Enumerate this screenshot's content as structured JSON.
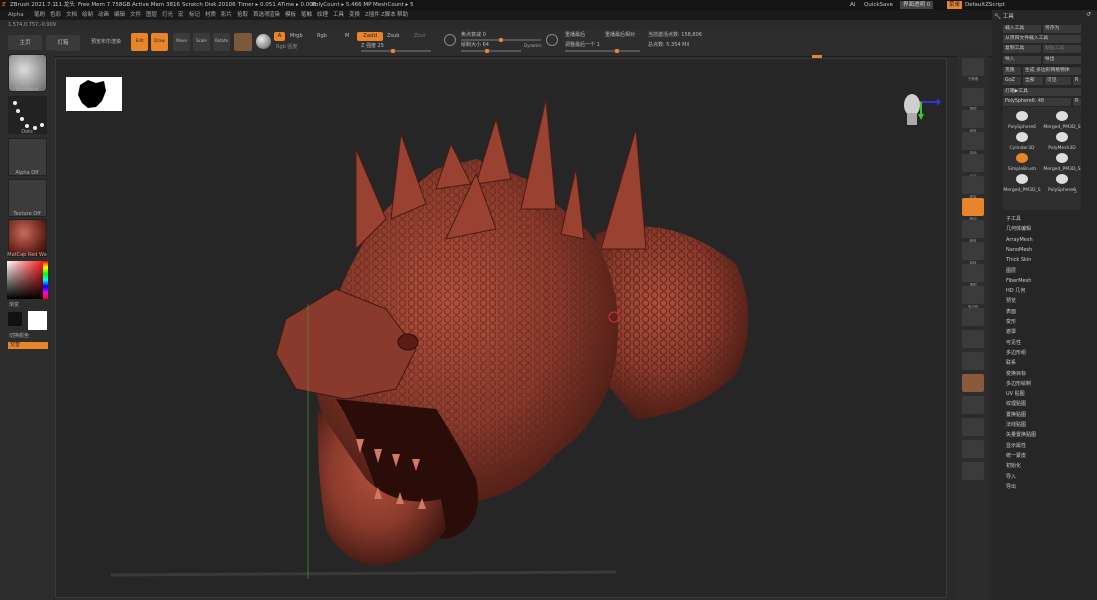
{
  "status": {
    "app": "ZBrush 2021.7.1",
    "tool": "11.龙头",
    "free_mem": "Free Mem 7.758GB",
    "active_mem": "Active Mem 3816",
    "scratch": "Scratch Disk 20106",
    "timer": "Timer ▸ 0.051 ATime ▸ 0.008",
    "polycount": "PolyCount ▸ 5.466 MP",
    "meshcount": "MeshCount ▸ 5",
    "quicksave": "QuickSave",
    "transp": "界面透明 0",
    "menu_label": "菜单",
    "script": "DefaultZScript",
    "ai": "AI"
  },
  "menus": [
    "Alpha",
    "笔刷",
    "色彩",
    "文档",
    "绘制",
    "动画",
    "编辑",
    "文件",
    "图层",
    "灯光",
    "宏",
    "标记",
    "材质",
    "影片",
    "拾取",
    "首选项",
    "渲染",
    "模板",
    "笔触",
    "纹理",
    "工具",
    "变换",
    "Z插件",
    "Z脚本",
    "帮助"
  ],
  "coordinates": "1.574,0.757,-0.909",
  "toolbar": {
    "home": "主页",
    "lightbox": "灯箱",
    "live_boolean": "预览布尔渲染",
    "edit": "Edit",
    "draw": "Draw",
    "move": "Move",
    "scale": "Scale",
    "rotate": "Rotate",
    "a": "A",
    "mrgb": "Mrgb",
    "rgb": "Rgb",
    "m": "M",
    "zadd": "Zadd",
    "zsub": "Zsub",
    "zcut": "Zcut",
    "rgb_intensity": "Rgb 强度",
    "z_intensity": "Z 强度 25",
    "focal": "焦点衰减 0",
    "draw_size": "绘制大小 64",
    "dynamic": "Dynamic",
    "replay_last": "重播最后",
    "replay_last_rel": "重播最后相对",
    "adjust_last": "调整最后一个 1",
    "active_points": "当前激活点数: 158,806",
    "total_points": "总点数: 5.354 Mil"
  },
  "left": {
    "standard": "Standard",
    "dots": "Dots",
    "alpha_off": "Alpha Off",
    "texture_off": "Texture Off",
    "matcap": "MatCap Red Wa",
    "gradient": "渐变",
    "switch_color": "切换颜色",
    "alternate": "交替"
  },
  "right_shelf": [
    "子像素",
    "透视",
    "地板",
    "本地",
    "XYZ",
    "框架",
    "移动",
    "缩放",
    "旋转",
    "透明",
    "多边形"
  ],
  "panel": {
    "title": "工具",
    "load": "载入工具",
    "save_as": "另存为",
    "copy_from": "从项目文件载入工具",
    "copy": "复制工具",
    "paste": "粘贴工具",
    "import": "导入",
    "export": "导出",
    "clone": "克隆",
    "make_poly": "生成 多边形网格物体",
    "goz": "GoZ",
    "all": "全部",
    "visible": "可见",
    "r": "R",
    "lightbox_tool": "灯箱▶工具",
    "current": "PolySphere6. 48",
    "r2": "R",
    "subtools_count": "5"
  },
  "tools": [
    "PolySphere6",
    "Merged_PM3D_S",
    "Cylinder3D",
    "PolyMesh3D",
    "SimpleBrush",
    "Merged_PM3D_S",
    "Merged_PM3D_S",
    "PolySphere6"
  ],
  "subpalettes": [
    "子工具",
    "几何体编辑",
    "ArrayMesh",
    "NanoMesh",
    "Thick Skin",
    "图层",
    "FiberMesh",
    "HD 几何",
    "预览",
    "表面",
    "变形",
    "遮罩",
    "可见性",
    "多边形组",
    "联系",
    "变换目标",
    "多边形绘制",
    "UV 贴图",
    "纹理贴图",
    "置换贴图",
    "法线贴图",
    "矢量置换贴图",
    "显示属性",
    "统一蒙皮",
    "初始化",
    "导入",
    "导出"
  ],
  "colors": {
    "accent": "#e8852a",
    "clay": "#8a3a2c"
  }
}
